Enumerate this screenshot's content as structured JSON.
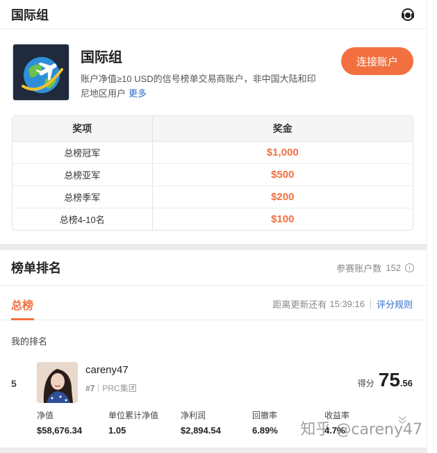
{
  "topbar": {
    "title": "国际组",
    "support_icon": "headset-icon"
  },
  "group": {
    "name": "国际组",
    "description": "账户净值≥10 USD的信号榜单交易商账户，非中国大陆和印尼地区用户",
    "more_link": "更多",
    "connect_button": "连接账户",
    "logo_icon": "globe-plane-icon"
  },
  "prizes": {
    "headers": [
      "奖项",
      "奖金"
    ],
    "rows": [
      {
        "name": "总榜冠军",
        "amount": "$1,000"
      },
      {
        "name": "总榜亚军",
        "amount": "$500"
      },
      {
        "name": "总榜季军",
        "amount": "$200"
      },
      {
        "name": "总榜4-10名",
        "amount": "$100"
      }
    ]
  },
  "ranking": {
    "title": "榜单排名",
    "participants_label": "参赛账户数",
    "participants_count": "152",
    "tab_main": "总榜",
    "update_label": "距离更新还有",
    "update_time": "15:39:16",
    "rules_link": "评分规则",
    "my_rank_label": "我的排名"
  },
  "my_entry": {
    "rank": "5",
    "username": "careny47",
    "rank_tag": "#7",
    "group_tag": "PRC集团",
    "score_label": "得分",
    "score_int": "75",
    "score_dec": ".56",
    "stats": [
      {
        "label": "净值",
        "value": "$58,676.34"
      },
      {
        "label": "单位累计净值",
        "value": "1.05"
      },
      {
        "label": "净利润",
        "value": "$2,894.54"
      },
      {
        "label": "回撤率",
        "value": "6.89%"
      },
      {
        "label": "收益率",
        "value": "4.7%"
      }
    ]
  },
  "watermark": "知乎 @careny47",
  "colors": {
    "accent": "#f2703f",
    "link": "#2f6bc8"
  }
}
